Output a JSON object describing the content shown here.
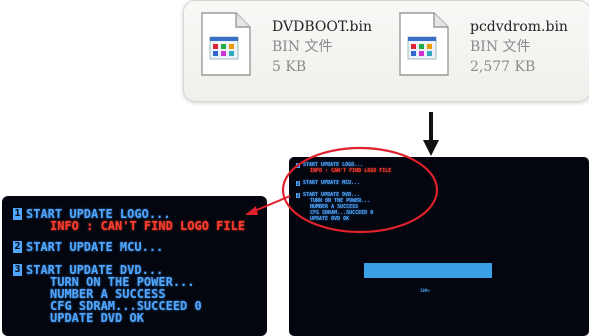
{
  "files": [
    {
      "name": "DVDBOOT.bin",
      "type": "BIN 文件",
      "size": "5 KB"
    },
    {
      "name": "pcdvdrom.bin",
      "type": "BIN 文件",
      "size": "2,577 KB"
    }
  ],
  "console": {
    "step1": {
      "num": "1",
      "title": "START UPDATE LOGO...",
      "info": "INFO : CAN'T FIND LOGO FILE"
    },
    "step2": {
      "num": "2",
      "title": "START UPDATE MCU..."
    },
    "step3": {
      "num": "3",
      "title": "START UPDATE DVD...",
      "l2": "TURN ON THE POWER...",
      "l3": "NUMBER A SUCCESS",
      "l4": "CFG SDRAM...SUCCEED 0",
      "l5": "UPDATE DVD OK"
    },
    "progress": {
      "percent_label": "100%",
      "value": 1.0
    }
  },
  "colors": {
    "console_bg": "#03060f",
    "console_text": "#4fa7ff",
    "error_text": "#ff3b2f",
    "callout": "#e0202a",
    "progress": "#3aa0e6"
  },
  "icons": [
    "bin-file-icon",
    "down-arrow-icon"
  ]
}
